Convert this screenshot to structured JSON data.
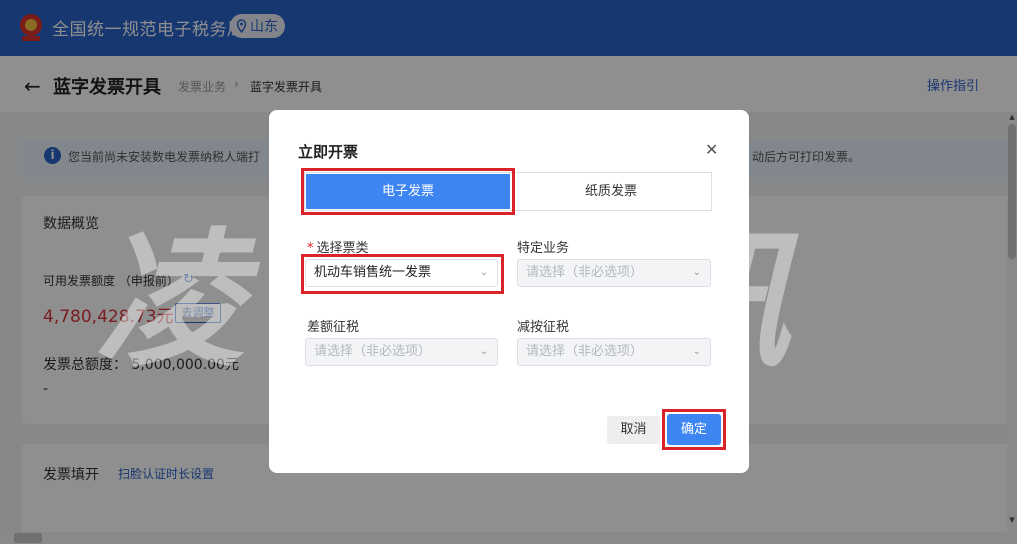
{
  "header": {
    "brand": "全国统一规范电子税务局",
    "location": "山东"
  },
  "page": {
    "title": "蓝字发票开具",
    "breadcrumb": [
      "发票业务",
      "蓝字发票开具"
    ],
    "guide_link": "操作指引",
    "back_icon": "arrow-left-icon"
  },
  "notice": {
    "text_left": "您当前尚未安装数电发票纳税人端打",
    "text_right": "动后方可打印发票。"
  },
  "overview": {
    "title": "数据概览",
    "quota_label": "可用发票额度 （申报前）",
    "quota_value": "4,780,428.73元",
    "adjust_button": "去调整",
    "total_label": "发票总额度：",
    "total_value": "5,000,000.00元",
    "dash": "-"
  },
  "fill": {
    "title": "发票填开",
    "face_link": "扫脸认证时长设置"
  },
  "watermark": "凌晓税讯",
  "modal": {
    "title": "立即开票",
    "tabs": [
      {
        "label": "电子发票",
        "active": true
      },
      {
        "label": "纸质发票",
        "active": false
      }
    ],
    "fields": {
      "ticket_type": {
        "label": "选择票类",
        "required_mark": "*",
        "value": "机动车销售统一发票"
      },
      "special_business": {
        "label": "特定业务",
        "placeholder": "请选择（非必选项）"
      },
      "diff_tax": {
        "label": "差额征税",
        "placeholder": "请选择（非必选项）"
      },
      "reduced_tax": {
        "label": "减按征税",
        "placeholder": "请选择（非必选项）"
      }
    },
    "cancel_button": "取消",
    "ok_button": "确定"
  },
  "colors": {
    "brand": "#2a63c9",
    "primary_button": "#3d86f2",
    "highlight_box": "#d8232a",
    "amount": "#d9363e"
  }
}
